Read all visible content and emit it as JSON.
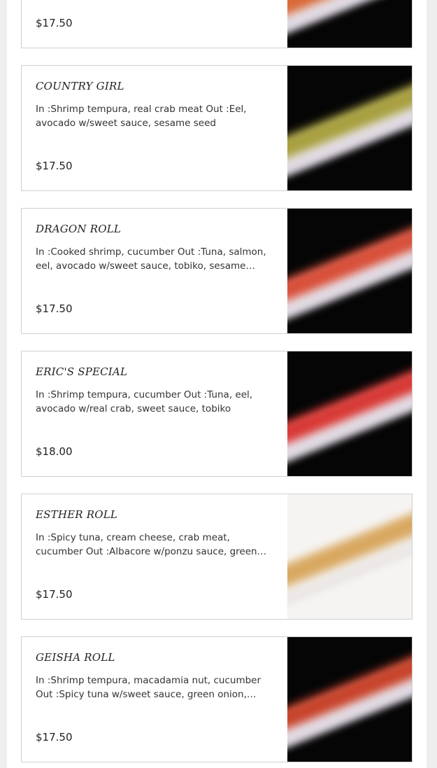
{
  "menu_items": [
    {
      "name": "",
      "description": "",
      "price": "$17.50",
      "image": "sushi-roll-photo",
      "roll_color": "#d96a3a"
    },
    {
      "name": "COUNTRY GIRL",
      "description": "In :Shrimp tempura, real crab meat Out :Eel, avocado w/sweet sauce, sesame seed",
      "price": "$17.50",
      "image": "sushi-roll-photo",
      "roll_color": "#a8a040"
    },
    {
      "name": "DRAGON ROLL",
      "description": "In :Cooked shrimp, cucumber Out :Tuna, salmon, eel, avocado w/sweet sauce, tobiko, sesame seed",
      "price": "$17.50",
      "image": "sushi-roll-photo",
      "roll_color": "#d8503a"
    },
    {
      "name": "ERIC'S SPECIAL",
      "description": "In :Shrimp tempura, cucumber Out :Tuna, eel, avocado w/real crab, sweet sauce, tobiko",
      "price": "$18.00",
      "image": "sushi-roll-photo",
      "roll_color": "#d83a36"
    },
    {
      "name": "ESTHER ROLL",
      "description": "In :Spicy tuna, cream cheese, crab meat, cucumber Out :Albacore w/ponzu sauce, green onion, tobiko",
      "price": "$17.50",
      "image": "sushi-roll-photo",
      "roll_color": "#d8a860"
    },
    {
      "name": "GEISHA ROLL",
      "description": "In :Shrimp tempura, macadamia nut, cucumber Out :Spicy tuna w/sweet sauce, green onion, tobiko",
      "price": "$17.50",
      "image": "sushi-roll-photo",
      "roll_color": "#c8442c"
    }
  ]
}
